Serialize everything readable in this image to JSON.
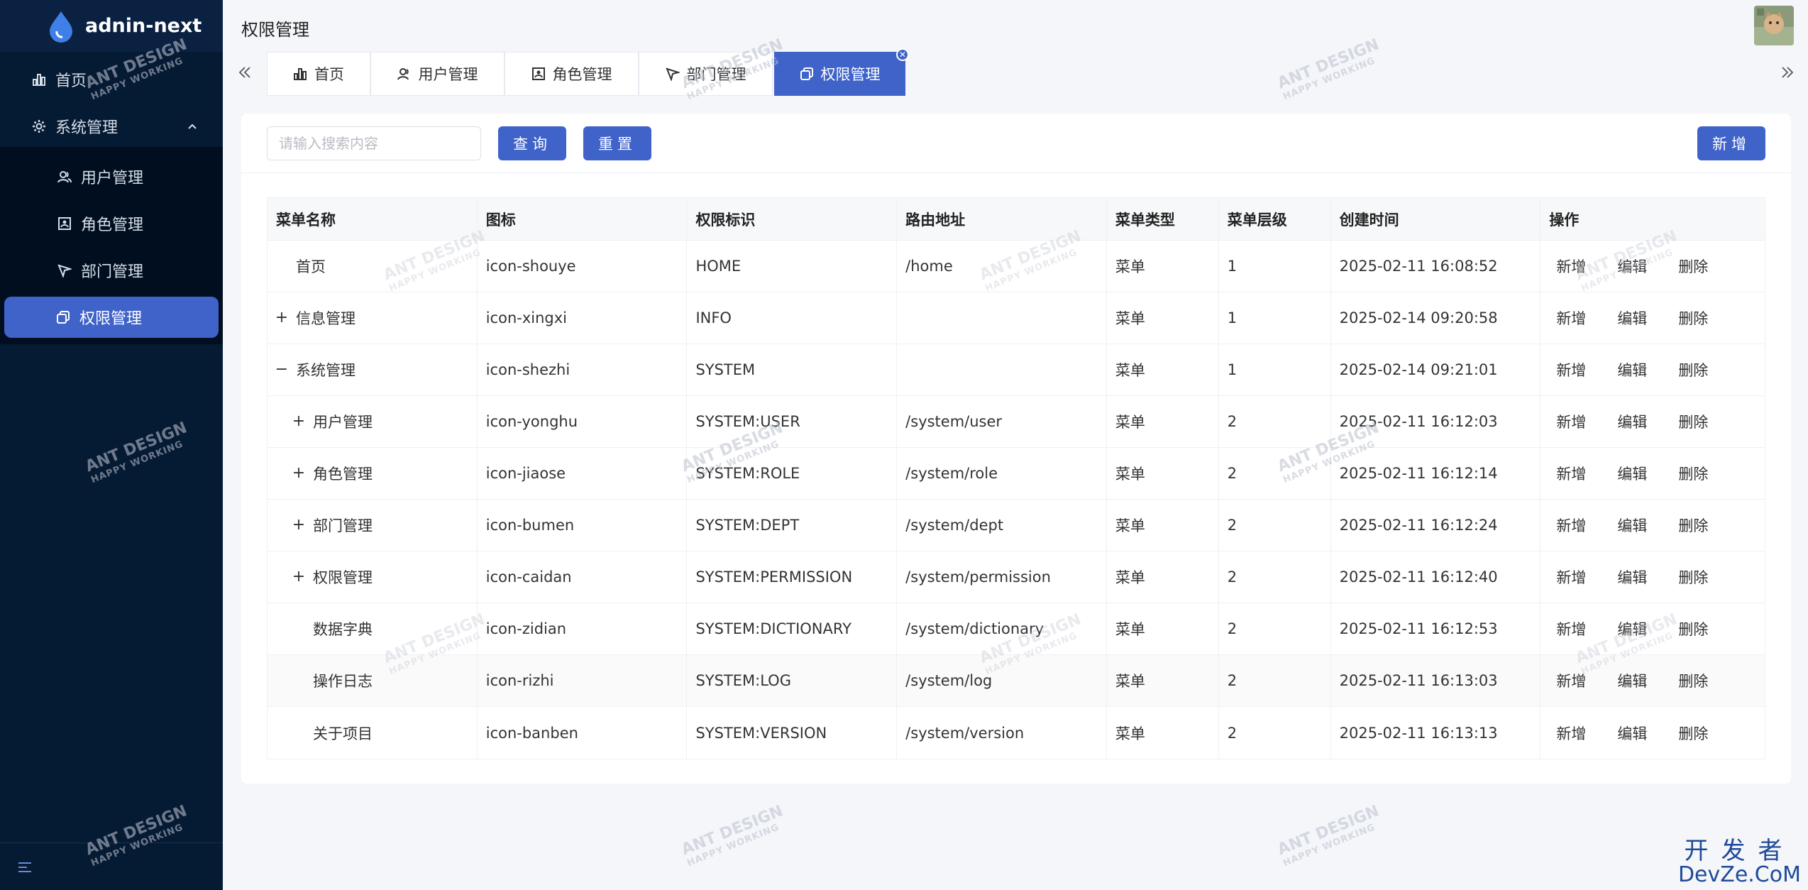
{
  "app": {
    "name": "adnin-next",
    "page_title": "权限管理"
  },
  "sidebar": {
    "items": [
      {
        "label": "首页",
        "icon": "bar-chart-icon"
      },
      {
        "label": "系统管理",
        "icon": "gear-icon"
      },
      {
        "label": "用户管理",
        "icon": "users-icon"
      },
      {
        "label": "角色管理",
        "icon": "id-card-icon"
      },
      {
        "label": "部门管理",
        "icon": "send-icon"
      },
      {
        "label": "权限管理",
        "icon": "copy-icon"
      }
    ],
    "active": "权限管理"
  },
  "tabs": [
    {
      "label": "首页",
      "icon": "bar-chart-icon"
    },
    {
      "label": "用户管理",
      "icon": "users-icon"
    },
    {
      "label": "角色管理",
      "icon": "id-card-icon"
    },
    {
      "label": "部门管理",
      "icon": "send-icon"
    },
    {
      "label": "权限管理",
      "icon": "copy-icon",
      "active": true
    }
  ],
  "toolbar": {
    "search_placeholder": "请输入搜索内容",
    "query_label": "查询",
    "reset_label": "重置",
    "add_label": "新增"
  },
  "table": {
    "headers": [
      "菜单名称",
      "图标",
      "权限标识",
      "路由地址",
      "菜单类型",
      "菜单层级",
      "创建时间",
      "操作"
    ],
    "actions": [
      "新增",
      "编辑",
      "删除"
    ],
    "rows": [
      {
        "name": "首页",
        "icon": "icon-shouye",
        "perm": "HOME",
        "route": "/home",
        "type": "菜单",
        "level": "1",
        "created": "2025-02-11 16:08:52",
        "expander": "",
        "indent": 0
      },
      {
        "name": "信息管理",
        "icon": "icon-xingxi",
        "perm": "INFO",
        "route": "",
        "type": "菜单",
        "level": "1",
        "created": "2025-02-14 09:20:58",
        "expander": "+",
        "indent": 0
      },
      {
        "name": "系统管理",
        "icon": "icon-shezhi",
        "perm": "SYSTEM",
        "route": "",
        "type": "菜单",
        "level": "1",
        "created": "2025-02-14 09:21:01",
        "expander": "−",
        "indent": 0
      },
      {
        "name": "用户管理",
        "icon": "icon-yonghu",
        "perm": "SYSTEM:USER",
        "route": "/system/user",
        "type": "菜单",
        "level": "2",
        "created": "2025-02-11 16:12:03",
        "expander": "+",
        "indent": 1
      },
      {
        "name": "角色管理",
        "icon": "icon-jiaose",
        "perm": "SYSTEM:ROLE",
        "route": "/system/role",
        "type": "菜单",
        "level": "2",
        "created": "2025-02-11 16:12:14",
        "expander": "+",
        "indent": 1
      },
      {
        "name": "部门管理",
        "icon": "icon-bumen",
        "perm": "SYSTEM:DEPT",
        "route": "/system/dept",
        "type": "菜单",
        "level": "2",
        "created": "2025-02-11 16:12:24",
        "expander": "+",
        "indent": 1
      },
      {
        "name": "权限管理",
        "icon": "icon-caidan",
        "perm": "SYSTEM:PERMISSION",
        "route": "/system/permission",
        "type": "菜单",
        "level": "2",
        "created": "2025-02-11 16:12:40",
        "expander": "+",
        "indent": 1
      },
      {
        "name": "数据字典",
        "icon": "icon-zidian",
        "perm": "SYSTEM:DICTIONARY",
        "route": "/system/dictionary",
        "type": "菜单",
        "level": "2",
        "created": "2025-02-11 16:12:53",
        "expander": "",
        "indent": 1
      },
      {
        "name": "操作日志",
        "icon": "icon-rizhi",
        "perm": "SYSTEM:LOG",
        "route": "/system/log",
        "type": "菜单",
        "level": "2",
        "created": "2025-02-11 16:13:03",
        "expander": "",
        "indent": 1
      },
      {
        "name": "关于项目",
        "icon": "icon-banben",
        "perm": "SYSTEM:VERSION",
        "route": "/system/version",
        "type": "菜单",
        "level": "2",
        "created": "2025-02-11 16:13:13",
        "expander": "",
        "indent": 1
      }
    ]
  },
  "watermark": {
    "line1": "ANT DESIGN",
    "line2": "HAPPY WORKING"
  },
  "brand_mark": {
    "line1": "开发者",
    "line2": "DevZe.CoM"
  },
  "colors": {
    "sidebar_bg": "#051a33",
    "accent": "#3f63c8",
    "page_bg": "#f4f6fa"
  }
}
